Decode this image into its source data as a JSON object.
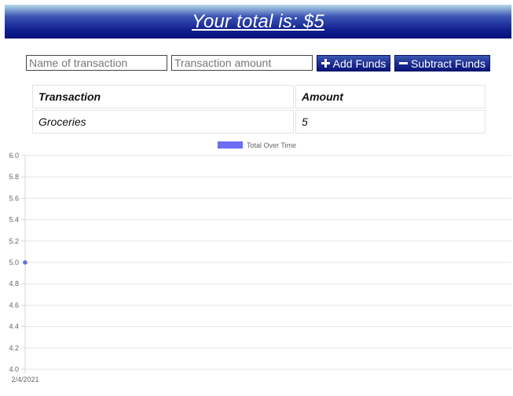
{
  "header": {
    "title": "Your total is: $5"
  },
  "form": {
    "name_placeholder": "Name of transaction",
    "amount_placeholder": "Transaction amount",
    "add_label": "Add Funds",
    "add_icon": "plus-icon",
    "subtract_label": "Subtract Funds",
    "subtract_icon": "minus-icon"
  },
  "table": {
    "headers": [
      "Transaction",
      "Amount"
    ],
    "rows": [
      [
        "Groceries",
        "5"
      ]
    ]
  },
  "colors": {
    "header_dark": "#06107a",
    "button_blue": "#1b2c8d",
    "series_fill": "#6c6cf5",
    "series_point": "#6a6af0"
  },
  "chart_data": {
    "type": "line",
    "legend": "top-center",
    "grid": true,
    "x": [
      "2/4/2021"
    ],
    "series": [
      {
        "name": "Total Over Time",
        "values": [
          5
        ]
      }
    ],
    "ylim": [
      4.0,
      6.0
    ],
    "yticks": [
      "6.0",
      "5.8",
      "5.6",
      "5.4",
      "5.2",
      "5.0",
      "4.8",
      "4.6",
      "4.4",
      "4.2",
      "4.0"
    ]
  }
}
